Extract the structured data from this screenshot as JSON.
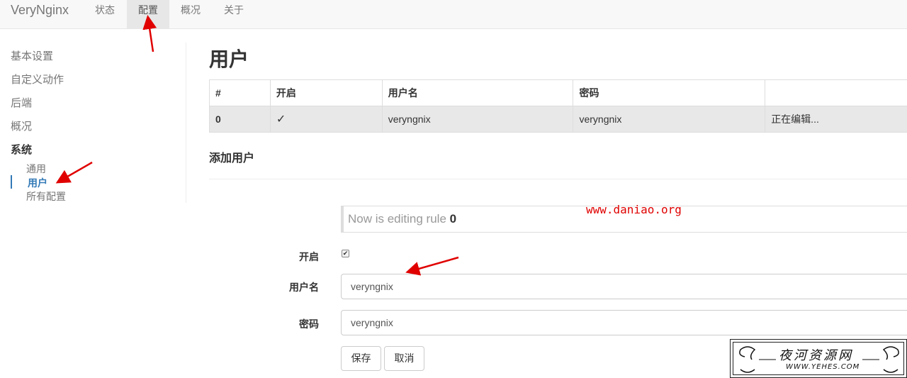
{
  "navbar": {
    "brand": "VeryNginx",
    "items": [
      {
        "label": "状态"
      },
      {
        "label": "配置",
        "active": true
      },
      {
        "label": "概况"
      },
      {
        "label": "关于"
      }
    ]
  },
  "sidebar": {
    "items": [
      "基本设置",
      "自定义动作",
      "后端",
      "概况"
    ],
    "section": "系统",
    "sub_items": [
      {
        "label": "通用"
      },
      {
        "label": "用户",
        "active": true
      },
      {
        "label": "所有配置"
      }
    ]
  },
  "main": {
    "title": "用户",
    "table": {
      "headers": [
        "#",
        "开启",
        "用户名",
        "密码",
        ""
      ],
      "rows": [
        {
          "index": "0",
          "enabled": "✓",
          "username": "veryngnix",
          "password": "veryngnix",
          "status": "正在编辑..."
        }
      ]
    },
    "add_title": "添加用户",
    "notice": {
      "text": "Now is editing rule",
      "rule": "0"
    },
    "form": {
      "enable_label": "开启",
      "enable_checked": true,
      "username_label": "用户名",
      "username_value": "veryngnix",
      "password_label": "密码",
      "password_value": "veryngnix",
      "save_label": "保存",
      "cancel_label": "取消"
    }
  },
  "watermarks": {
    "url": "www.daniao.org",
    "seal_title": "夜河资源网",
    "seal_subtitle": "WWW.YEHES.COM"
  },
  "colors": {
    "accent": "#337ab7",
    "annotation": "#e00000"
  }
}
